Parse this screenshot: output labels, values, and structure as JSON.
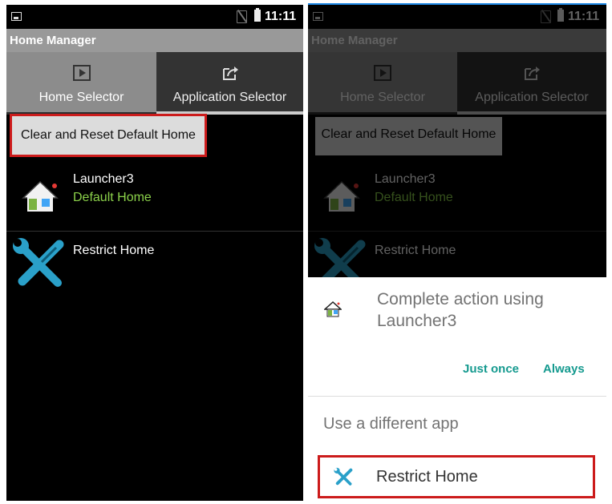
{
  "status_bar": {
    "time": "11:11"
  },
  "app": {
    "title": "Home Manager"
  },
  "tabs": [
    {
      "label": "Home Selector",
      "icon": "play-icon"
    },
    {
      "label": "Application Selector",
      "icon": "share-icon"
    }
  ],
  "clear_button": {
    "label": "Clear and Reset Default Home"
  },
  "home_list": [
    {
      "title": "Launcher3",
      "subtitle": "Default Home",
      "icon": "house-icon"
    },
    {
      "title": "Restrict Home",
      "icon": "wrench-screwdriver-icon"
    }
  ],
  "chooser": {
    "title": "Complete action using Launcher3",
    "just_once": "Just once",
    "always": "Always",
    "use_different": "Use a different app",
    "option": "Restrict Home"
  },
  "colors": {
    "highlight": "#cc1b1b",
    "accent": "#159a8f",
    "default_home": "#8bd14a"
  }
}
